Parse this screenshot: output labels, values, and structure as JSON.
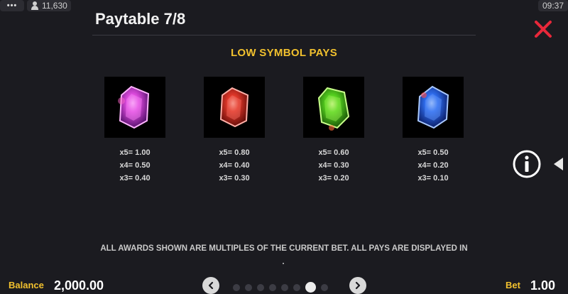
{
  "status_bar": {
    "menu_dots": "•••",
    "player_count": "11,630",
    "clock": "09:37"
  },
  "header": {
    "title": "Paytable 7/8"
  },
  "section": {
    "title": "LOW SYMBOL PAYS"
  },
  "symbols": [
    {
      "gem": "pink-gem",
      "color": "#d93ad6",
      "pays": [
        "x5= 1.00",
        "x4= 0.50",
        "x3= 0.40"
      ]
    },
    {
      "gem": "red-gem",
      "color": "#e0382a",
      "pays": [
        "x5= 0.80",
        "x4= 0.40",
        "x3= 0.30"
      ]
    },
    {
      "gem": "green-gem",
      "color": "#57d420",
      "pays": [
        "x5= 0.60",
        "x4= 0.30",
        "x3= 0.20"
      ]
    },
    {
      "gem": "blue-gem",
      "color": "#2f6ef0",
      "pays": [
        "x5= 0.50",
        "x4= 0.20",
        "x3= 0.10"
      ]
    }
  ],
  "footer_note": "ALL AWARDS SHOWN ARE MULTIPLES OF THE CURRENT BET. ALL PAYS ARE DISPLAYED IN",
  "bottom_bar": {
    "balance_label": "Balance",
    "balance_value": "2,000.00",
    "bet_label": "Bet",
    "bet_value": "1.00",
    "pages_total": 7,
    "page_active": 6
  },
  "colors": {
    "accent": "#f2c12e",
    "close": "#e8283a",
    "background": "#1b1b20"
  }
}
